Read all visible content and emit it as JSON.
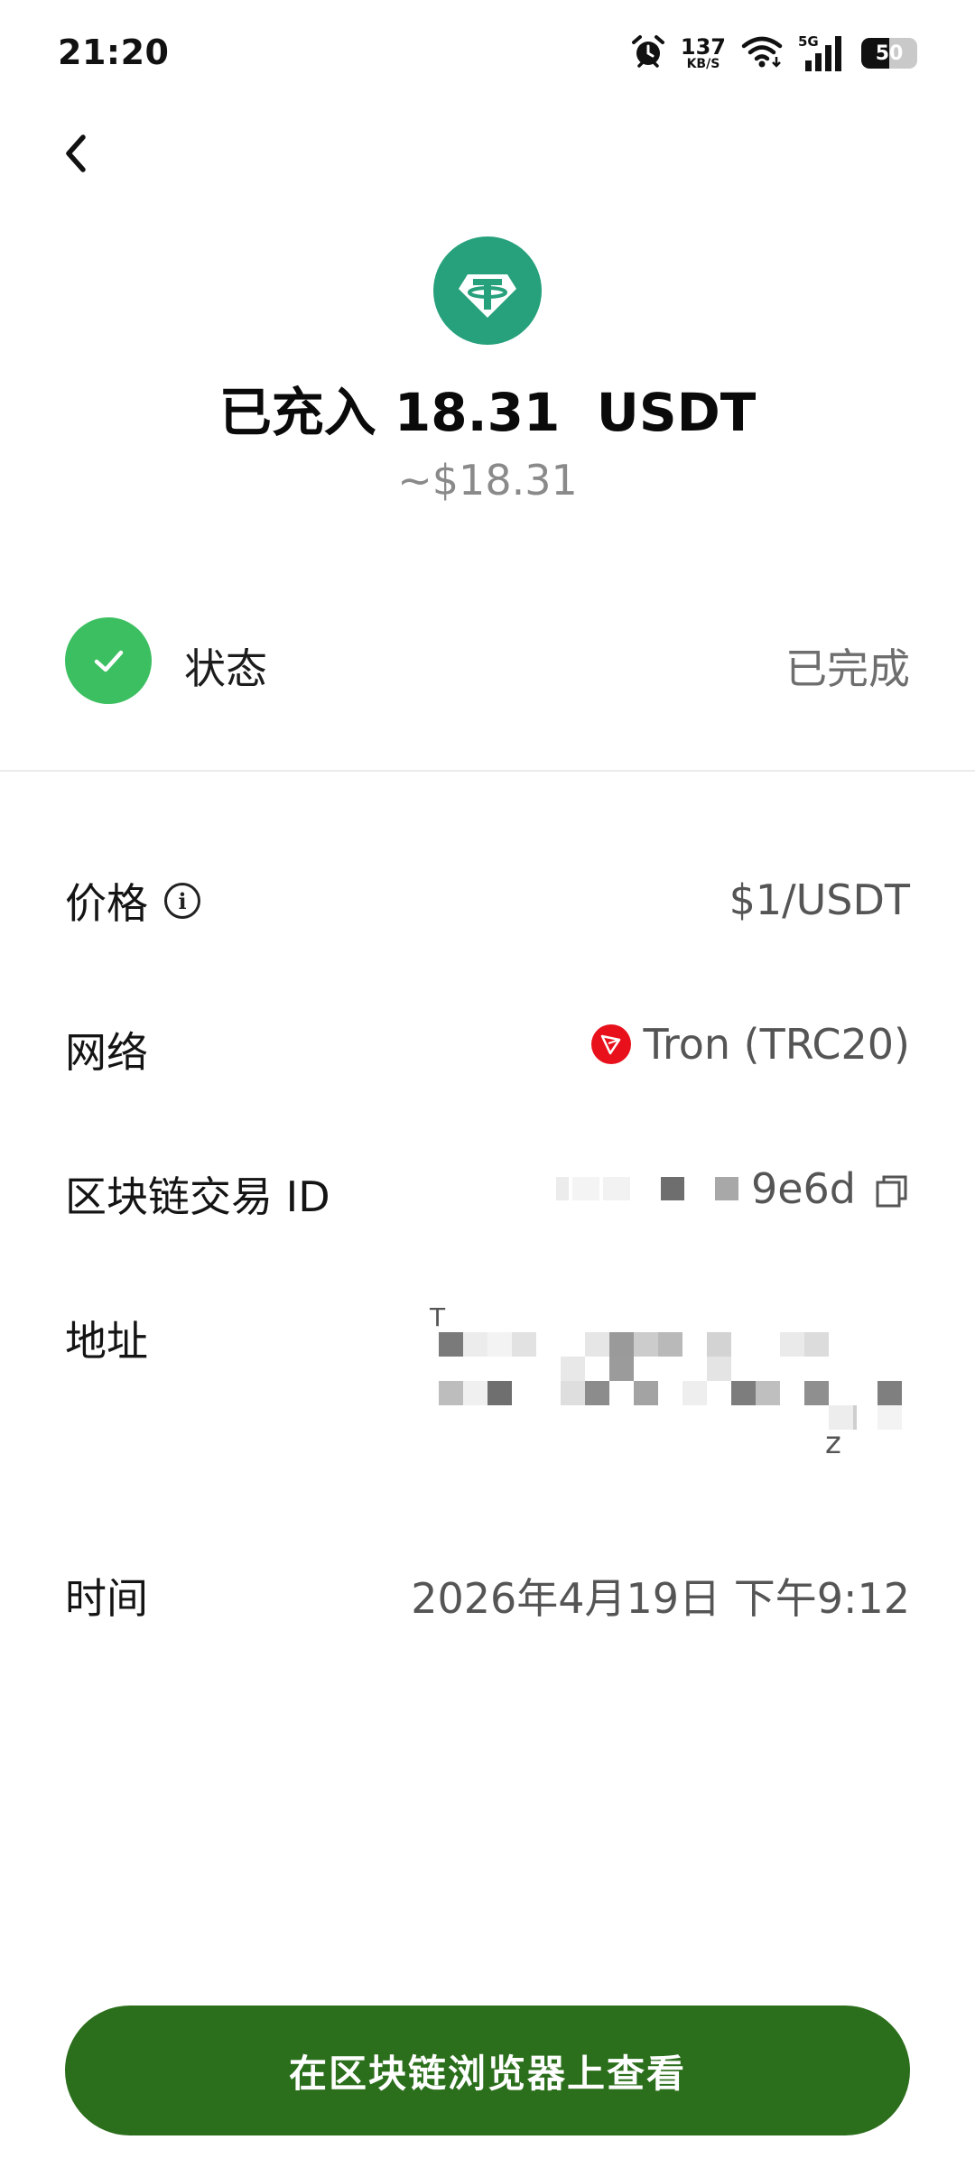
{
  "status_bar": {
    "time": "21:20",
    "net_speed_value": "137",
    "net_speed_unit": "KB/S",
    "network_type": "5G",
    "battery_level": "50",
    "battery_fraction": 0.5,
    "icons": [
      "alarm-icon",
      "wifi-icon",
      "cellular-signal-icon",
      "battery-icon"
    ]
  },
  "header": {
    "token_icon": "tether-usdt-icon",
    "title": "已充入 18.31  USDT",
    "usd_value": "~$18.31"
  },
  "status": {
    "label": "状态",
    "value": "已完成",
    "icon": "check-circle-icon"
  },
  "details": {
    "price": {
      "label": "价格",
      "value": "$1/USDT"
    },
    "network": {
      "label": "网络",
      "value": "Tron (TRC20)",
      "icon": "tron-icon"
    },
    "txid": {
      "label": "区块链交易 ID",
      "value_suffix": "9e6d",
      "redacted": true
    },
    "address": {
      "label": "地址",
      "visible_prefix": "T",
      "visible_suffix": "z",
      "redacted": true
    },
    "time": {
      "label": "时间",
      "value": "2026年4月19日 下午9:12"
    }
  },
  "action": {
    "explorer_button_label": "在区块链浏览器上查看"
  },
  "colors": {
    "accent_green": "#2b6e1b",
    "status_green": "#3cbf61",
    "tether_teal": "#26a17b",
    "tron_red": "#e8101b",
    "muted_text": "#8a8a8a"
  }
}
